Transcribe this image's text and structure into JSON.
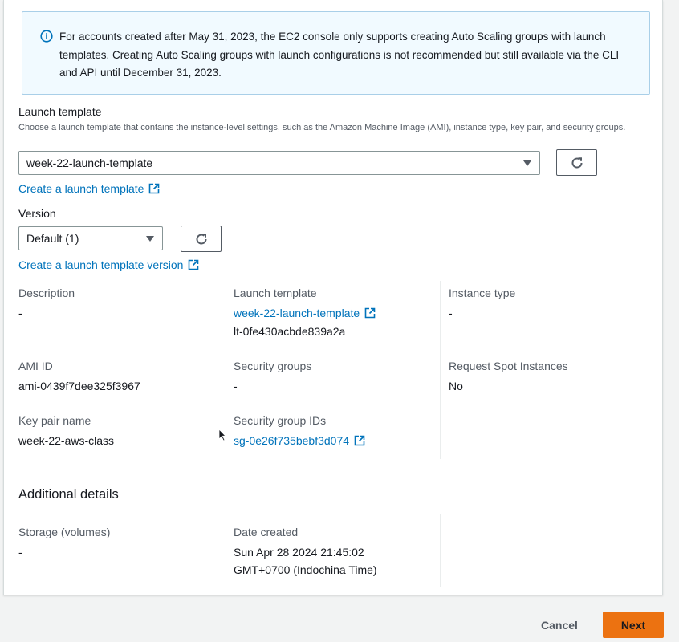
{
  "info": {
    "icon": "info-icon",
    "text": "For accounts created after May 31, 2023, the EC2 console only supports creating Auto Scaling groups with launch templates. Creating Auto Scaling groups with launch configurations is not recommended but still available via the CLI and API until December 31, 2023."
  },
  "launch_template": {
    "label": "Launch template",
    "description": "Choose a launch template that contains the instance-level settings, such as the Amazon Machine Image (AMI), instance type, key pair, and security groups.",
    "selected": "week-22-launch-template",
    "create_link": "Create a launch template"
  },
  "version": {
    "label": "Version",
    "selected": "Default (1)",
    "create_link": "Create a launch template version"
  },
  "details": {
    "description_label": "Description",
    "description_value": "-",
    "launch_template_label": "Launch template",
    "launch_template_link": "week-22-launch-template",
    "launch_template_id": "lt-0fe430acbde839a2a",
    "instance_type_label": "Instance type",
    "instance_type_value": "-",
    "ami_label": "AMI ID",
    "ami_value": "ami-0439f7dee325f3967",
    "security_groups_label": "Security groups",
    "security_groups_value": "-",
    "spot_label": "Request Spot Instances",
    "spot_value": "No",
    "key_pair_label": "Key pair name",
    "key_pair_value": "week-22-aws-class",
    "sg_ids_label": "Security group IDs",
    "sg_ids_link": "sg-0e26f735bebf3d074"
  },
  "additional": {
    "title": "Additional details",
    "storage_label": "Storage (volumes)",
    "storage_value": "-",
    "date_label": "Date created",
    "date_value_line1": "Sun Apr 28 2024 21:45:02",
    "date_value_line2": "GMT+0700 (Indochina Time)"
  },
  "footer": {
    "cancel": "Cancel",
    "next": "Next"
  },
  "colors": {
    "link": "#0073bb",
    "primary": "#ec7211",
    "info_bg": "#f1faff"
  }
}
